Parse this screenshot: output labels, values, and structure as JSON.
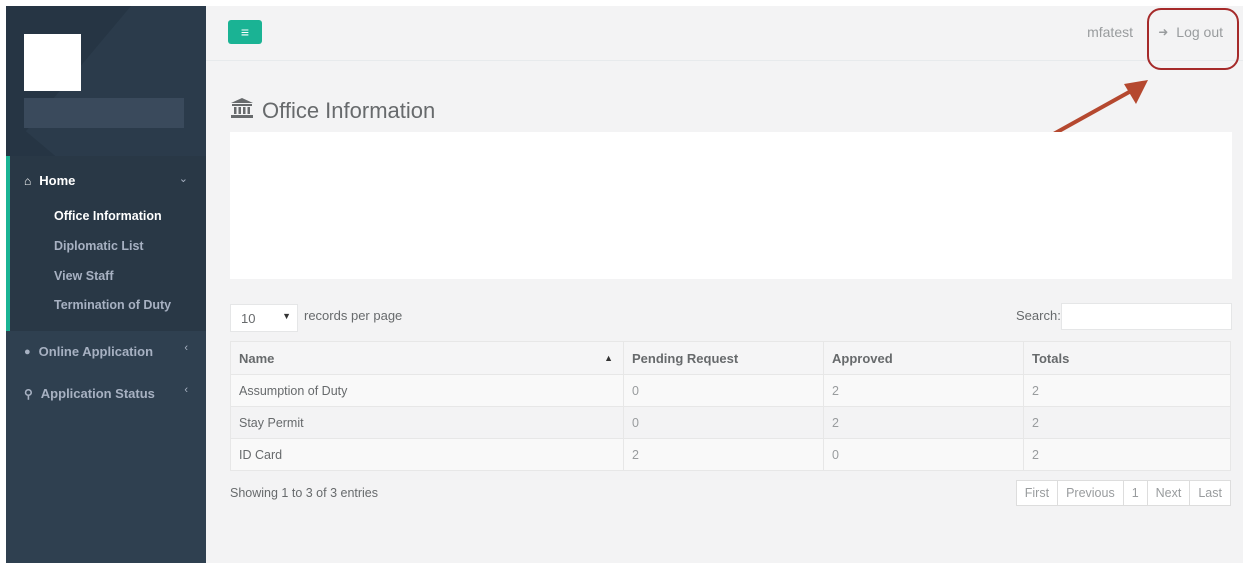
{
  "colors": {
    "sidebar": "#2f4050",
    "accent": "#1ab394",
    "annotation": "#b5482f"
  },
  "sidebar": {
    "home_label": "Home",
    "home_icon": "home-icon",
    "submenu": [
      "Office Information",
      "Diplomatic List",
      "View Staff",
      "Termination of Duty"
    ],
    "online_application_label": "Online Application",
    "online_application_icon": "user-icon",
    "application_status_label": "Application Status",
    "application_status_icon": "search-icon"
  },
  "topbar": {
    "menu_icon": "hamburger-icon",
    "username": "mfatest",
    "logout_label": "Log out",
    "logout_icon": "sign-out-icon"
  },
  "page": {
    "title": "Office Information",
    "title_icon": "institution-icon"
  },
  "table_controls": {
    "page_length": "10",
    "page_length_label": "records per page",
    "search_label": "Search:"
  },
  "table": {
    "columns": [
      "Name",
      "Pending Request",
      "Approved",
      "Totals"
    ],
    "rows": [
      [
        "Assumption of Duty",
        "0",
        "2",
        "2"
      ],
      [
        "Stay Permit",
        "0",
        "2",
        "2"
      ],
      [
        "ID Card",
        "2",
        "0",
        "2"
      ]
    ]
  },
  "footer": {
    "info": "Showing 1 to 3 of 3 entries",
    "pagination": [
      "First",
      "Previous",
      "1",
      "Next",
      "Last"
    ]
  }
}
